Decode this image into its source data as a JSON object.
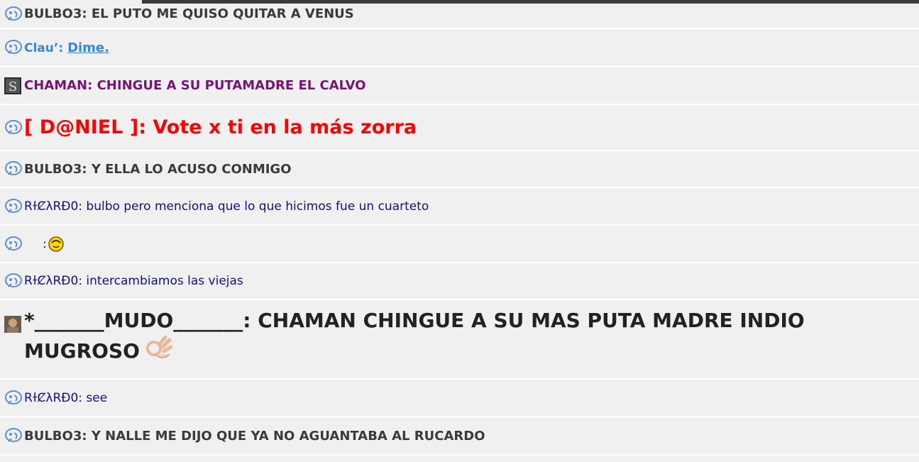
{
  "colors": {
    "bulbo": "#3a3a3a",
    "clau": "#3a86d6",
    "chaman": "#7a1178",
    "daniel": "#ff0000",
    "ricardo": "#101080",
    "mudo": "#222222"
  },
  "messages": [
    {
      "author": "BULBO3",
      "separator": ": ",
      "text": "EL PUTO ME QUISO QUITAR A VENUS",
      "icon": "msn-bird-icon"
    },
    {
      "author": "Clau’",
      "separator": ": ",
      "text": "Dime.",
      "icon": "msn-bird-icon"
    },
    {
      "author": "CHAMAN",
      "separator": ": ",
      "text": "CHINGUE A SU PUTAMADRE EL CALVO",
      "icon": "avatar-image-icon"
    },
    {
      "author": "[ D@NIEL ]",
      "separator": ": ",
      "text": "Vote x ti en la más zorra",
      "icon": "msn-bird-icon"
    },
    {
      "author": "BULBO3",
      "separator": ": ",
      "text": "Y ELLA LO ACUSO CONMIGO",
      "icon": "msn-bird-icon"
    },
    {
      "author": "RɫȻλRĐ0",
      "separator": ": ",
      "text": "bulbo pero menciona que lo que hicimos fue un cuarteto",
      "icon": "msn-bird-icon"
    },
    {
      "author": "",
      "separator": ":",
      "text": "",
      "icon": "msn-bird-icon",
      "emoticon": "smiley-emoticon-icon"
    },
    {
      "author": "RɫȻλRĐ0",
      "separator": ": ",
      "text": "intercambiamos las viejas",
      "icon": "msn-bird-icon"
    },
    {
      "author": "*_______MUDO_______",
      "separator": ": ",
      "text": "CHAMAN CHINGUE A SU MAS PUTA MADRE INDIO",
      "text2": "MUGROSO",
      "icon": "avatar-image-icon",
      "emoticon": "ok-hand-icon"
    },
    {
      "author": "RɫȻλRĐ0",
      "separator": ": ",
      "text": "see",
      "icon": "msn-bird-icon"
    },
    {
      "author": "BULBO3",
      "separator": ": ",
      "text": "Y NALLE ME DIJO QUE YA NO AGUANTABA AL RUCARDO",
      "icon": "msn-bird-icon"
    }
  ]
}
